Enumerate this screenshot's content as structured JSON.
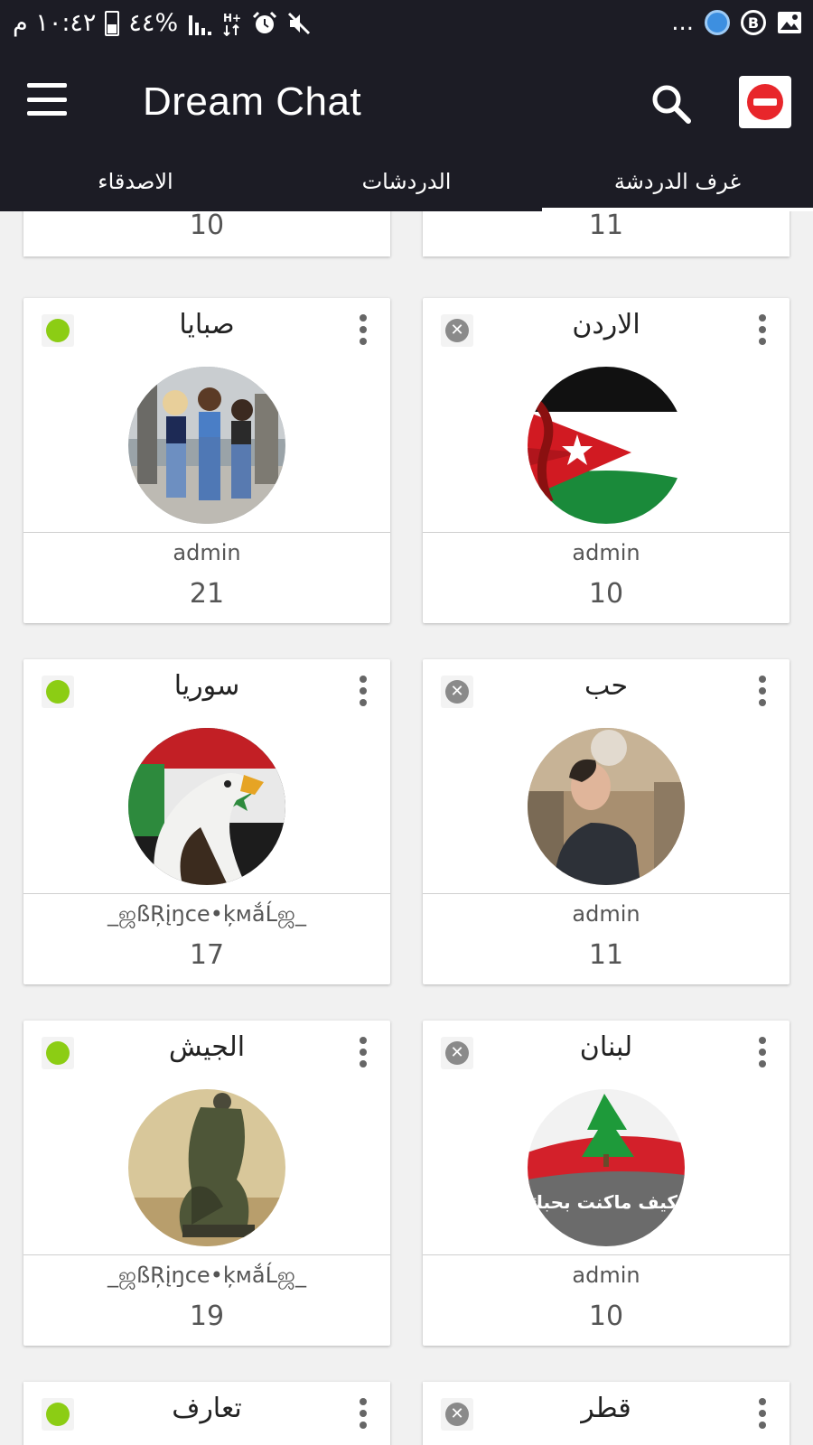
{
  "status_bar": {
    "time": "١٠:٤٢ م",
    "battery": "٤٤%",
    "more": "..."
  },
  "app": {
    "title": "Dream Chat"
  },
  "tabs": [
    {
      "label": "الاصدقاء"
    },
    {
      "label": "الدردشات"
    },
    {
      "label": "غرف الدردشة",
      "active": true
    }
  ],
  "rooms": {
    "partial_left_count": "10",
    "partial_right_count": "11",
    "cards": [
      {
        "name": "صبايا",
        "status": "online",
        "owner": "admin",
        "count": "21"
      },
      {
        "name": "الاردن",
        "status": "closed",
        "owner": "admin",
        "count": "10"
      },
      {
        "name": "سوريا",
        "status": "online",
        "owner": "_ஜßŖįŋce•ķмắĹஜ_",
        "count": "17"
      },
      {
        "name": "حب",
        "status": "closed",
        "owner": "admin",
        "count": "11"
      },
      {
        "name": "الجيش",
        "status": "online",
        "owner": "_ஜßŖįŋce•ķмắĹஜ_",
        "count": "19"
      },
      {
        "name": "لبنان",
        "status": "closed",
        "owner": "admin",
        "count": "10"
      },
      {
        "name": "تعارف",
        "status": "online"
      },
      {
        "name": "قطر",
        "status": "closed"
      }
    ],
    "lebanon_image_text": "كيف ماكنت بحبك!"
  },
  "icons": {
    "menu": "menu-icon",
    "search": "search-icon",
    "block": "block-icon",
    "online": "online-dot-icon",
    "closed": "closed-x-icon",
    "more": "more-vert-icon"
  },
  "colors": {
    "bar_bg": "#1c1c25",
    "online_green": "#8ccd14",
    "block_red": "#e8262b",
    "page_bg": "#f1f1f1"
  }
}
